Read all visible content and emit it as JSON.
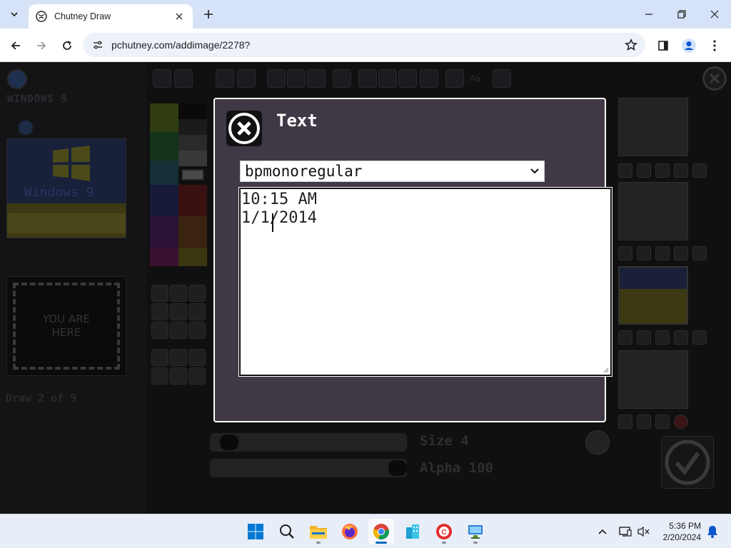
{
  "browser": {
    "tab_title": "Chutney Draw",
    "url": "pchutney.com/addimage/2278?"
  },
  "app": {
    "dim_title": "WINDOWS 9",
    "thumbnail_text": "Windows 9",
    "here_text": "YOU ARE\nHERE",
    "draw_label": "Draw 2 of 9",
    "top_tool_text": "Aa",
    "size_label": "Size 4",
    "alpha_label": "Alpha 100",
    "size_value": 4,
    "alpha_value": 100
  },
  "modal": {
    "title": "Text",
    "font_value": "bpmonoregular",
    "text_lines": [
      "10:15 AM",
      "1/1/2014"
    ]
  },
  "taskbar": {
    "time": "5:36 PM",
    "date": "2/20/2024",
    "apps": [
      "windows-start",
      "search",
      "file-explorer",
      "firefox",
      "chrome",
      "app-building",
      "app-red-circle",
      "app-monitor"
    ],
    "active_app": "chrome"
  },
  "colors": {
    "modal_bg": "#413845",
    "chrome_tab_strip": "#d6e2f8",
    "accent": "#0067c0"
  }
}
